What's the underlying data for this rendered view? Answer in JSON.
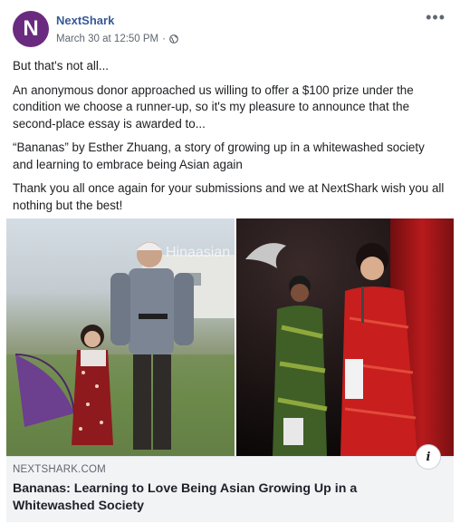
{
  "post": {
    "page_name": "NextShark",
    "avatar_letter": "N",
    "timestamp": "March 30 at 12:50 PM",
    "separator": "·",
    "more_label": "•••",
    "paragraphs": [
      "But that's not all...",
      "An anonymous donor approached us willing to offer a $100 prize under the condition we choose a runner-up, so it's my pleasure to announce that the second-place essay is awarded to...",
      "“Bananas” by Esther Zhuang, a story of growing up in a whitewashed society and learning to embrace being Asian again",
      "Thank you all once again for your submissions and we at NextShark wish you all nothing but the best!"
    ]
  },
  "link_preview": {
    "watermark": "Hinaasian",
    "domain": "NEXTSHARK.COM",
    "headline": "Bananas: Learning to Love Being Asian Growing Up in a Whitewashed Society",
    "info_icon": "i"
  },
  "colors": {
    "avatar": "#6a2a7f",
    "page_name": "#385898",
    "footer_bg": "#f2f3f5"
  }
}
